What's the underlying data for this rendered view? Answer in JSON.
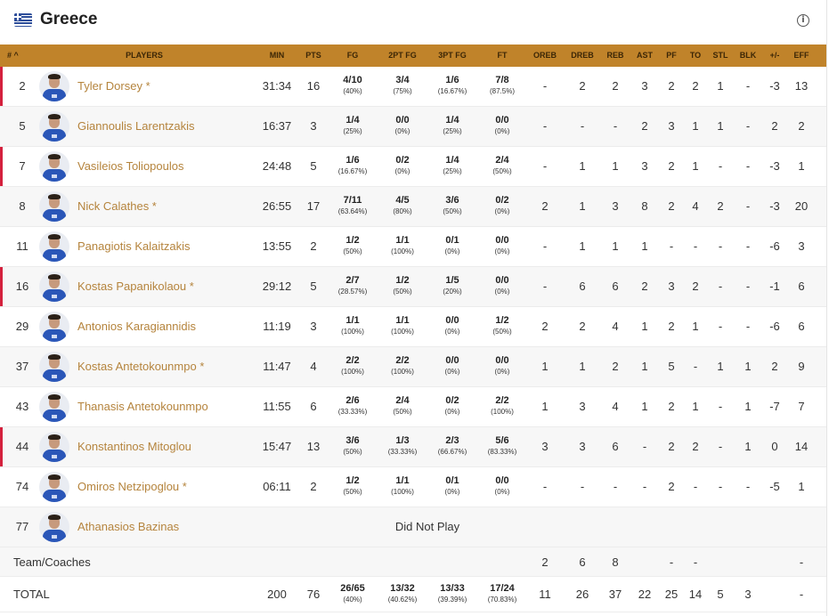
{
  "team": {
    "name": "Greece",
    "flag_icon": "greece-flag-icon",
    "info_icon": "info-icon"
  },
  "columns": [
    "#",
    "PLAYERS",
    "MIN",
    "PTS",
    "FG",
    "2PT FG",
    "3PT FG",
    "FT",
    "OREB",
    "DREB",
    "REB",
    "AST",
    "PF",
    "TO",
    "STL",
    "BLK",
    "+/-",
    "EFF"
  ],
  "sort_indicator": "^",
  "players": [
    {
      "num": "2",
      "name": "Tyler Dorsey *",
      "min": "31:34",
      "pts": "16",
      "fg": "4/10",
      "fg_pct": "(40%)",
      "fg2": "3/4",
      "fg2_pct": "(75%)",
      "fg3": "1/6",
      "fg3_pct": "(16.67%)",
      "ft": "7/8",
      "ft_pct": "(87.5%)",
      "oreb": "-",
      "dreb": "2",
      "reb": "2",
      "ast": "3",
      "pf": "2",
      "to": "2",
      "stl": "1",
      "blk": "-",
      "pm": "-3",
      "eff": "13",
      "marker": true
    },
    {
      "num": "5",
      "name": "Giannoulis Larentzakis",
      "min": "16:37",
      "pts": "3",
      "fg": "1/4",
      "fg_pct": "(25%)",
      "fg2": "0/0",
      "fg2_pct": "(0%)",
      "fg3": "1/4",
      "fg3_pct": "(25%)",
      "ft": "0/0",
      "ft_pct": "(0%)",
      "oreb": "-",
      "dreb": "-",
      "reb": "-",
      "ast": "2",
      "pf": "3",
      "to": "1",
      "stl": "1",
      "blk": "-",
      "pm": "2",
      "eff": "2",
      "marker": false
    },
    {
      "num": "7",
      "name": "Vasileios Toliopoulos",
      "min": "24:48",
      "pts": "5",
      "fg": "1/6",
      "fg_pct": "(16.67%)",
      "fg2": "0/2",
      "fg2_pct": "(0%)",
      "fg3": "1/4",
      "fg3_pct": "(25%)",
      "ft": "2/4",
      "ft_pct": "(50%)",
      "oreb": "-",
      "dreb": "1",
      "reb": "1",
      "ast": "3",
      "pf": "2",
      "to": "1",
      "stl": "-",
      "blk": "-",
      "pm": "-3",
      "eff": "1",
      "marker": true
    },
    {
      "num": "8",
      "name": "Nick Calathes *",
      "min": "26:55",
      "pts": "17",
      "fg": "7/11",
      "fg_pct": "(63.64%)",
      "fg2": "4/5",
      "fg2_pct": "(80%)",
      "fg3": "3/6",
      "fg3_pct": "(50%)",
      "ft": "0/2",
      "ft_pct": "(0%)",
      "oreb": "2",
      "dreb": "1",
      "reb": "3",
      "ast": "8",
      "pf": "2",
      "to": "4",
      "stl": "2",
      "blk": "-",
      "pm": "-3",
      "eff": "20",
      "marker": false
    },
    {
      "num": "11",
      "name": "Panagiotis Kalaitzakis",
      "min": "13:55",
      "pts": "2",
      "fg": "1/2",
      "fg_pct": "(50%)",
      "fg2": "1/1",
      "fg2_pct": "(100%)",
      "fg3": "0/1",
      "fg3_pct": "(0%)",
      "ft": "0/0",
      "ft_pct": "(0%)",
      "oreb": "-",
      "dreb": "1",
      "reb": "1",
      "ast": "1",
      "pf": "-",
      "to": "-",
      "stl": "-",
      "blk": "-",
      "pm": "-6",
      "eff": "3",
      "marker": false
    },
    {
      "num": "16",
      "name": "Kostas Papanikolaou *",
      "min": "29:12",
      "pts": "5",
      "fg": "2/7",
      "fg_pct": "(28.57%)",
      "fg2": "1/2",
      "fg2_pct": "(50%)",
      "fg3": "1/5",
      "fg3_pct": "(20%)",
      "ft": "0/0",
      "ft_pct": "(0%)",
      "oreb": "-",
      "dreb": "6",
      "reb": "6",
      "ast": "2",
      "pf": "3",
      "to": "2",
      "stl": "-",
      "blk": "-",
      "pm": "-1",
      "eff": "6",
      "marker": true
    },
    {
      "num": "29",
      "name": "Antonios Karagiannidis",
      "min": "11:19",
      "pts": "3",
      "fg": "1/1",
      "fg_pct": "(100%)",
      "fg2": "1/1",
      "fg2_pct": "(100%)",
      "fg3": "0/0",
      "fg3_pct": "(0%)",
      "ft": "1/2",
      "ft_pct": "(50%)",
      "oreb": "2",
      "dreb": "2",
      "reb": "4",
      "ast": "1",
      "pf": "2",
      "to": "1",
      "stl": "-",
      "blk": "-",
      "pm": "-6",
      "eff": "6",
      "marker": false
    },
    {
      "num": "37",
      "name": "Kostas Antetokounmpo *",
      "min": "11:47",
      "pts": "4",
      "fg": "2/2",
      "fg_pct": "(100%)",
      "fg2": "2/2",
      "fg2_pct": "(100%)",
      "fg3": "0/0",
      "fg3_pct": "(0%)",
      "ft": "0/0",
      "ft_pct": "(0%)",
      "oreb": "1",
      "dreb": "1",
      "reb": "2",
      "ast": "1",
      "pf": "5",
      "to": "-",
      "stl": "1",
      "blk": "1",
      "pm": "2",
      "eff": "9",
      "marker": false
    },
    {
      "num": "43",
      "name": "Thanasis Antetokounmpo",
      "min": "11:55",
      "pts": "6",
      "fg": "2/6",
      "fg_pct": "(33.33%)",
      "fg2": "2/4",
      "fg2_pct": "(50%)",
      "fg3": "0/2",
      "fg3_pct": "(0%)",
      "ft": "2/2",
      "ft_pct": "(100%)",
      "oreb": "1",
      "dreb": "3",
      "reb": "4",
      "ast": "1",
      "pf": "2",
      "to": "1",
      "stl": "-",
      "blk": "1",
      "pm": "-7",
      "eff": "7",
      "marker": false
    },
    {
      "num": "44",
      "name": "Konstantinos Mitoglou",
      "min": "15:47",
      "pts": "13",
      "fg": "3/6",
      "fg_pct": "(50%)",
      "fg2": "1/3",
      "fg2_pct": "(33.33%)",
      "fg3": "2/3",
      "fg3_pct": "(66.67%)",
      "ft": "5/6",
      "ft_pct": "(83.33%)",
      "oreb": "3",
      "dreb": "3",
      "reb": "6",
      "ast": "-",
      "pf": "2",
      "to": "2",
      "stl": "-",
      "blk": "1",
      "pm": "0",
      "eff": "14",
      "marker": true
    },
    {
      "num": "74",
      "name": "Omiros Netzipoglou *",
      "min": "06:11",
      "pts": "2",
      "fg": "1/2",
      "fg_pct": "(50%)",
      "fg2": "1/1",
      "fg2_pct": "(100%)",
      "fg3": "0/1",
      "fg3_pct": "(0%)",
      "ft": "0/0",
      "ft_pct": "(0%)",
      "oreb": "-",
      "dreb": "-",
      "reb": "-",
      "ast": "-",
      "pf": "2",
      "to": "-",
      "stl": "-",
      "blk": "-",
      "pm": "-5",
      "eff": "1",
      "marker": false
    },
    {
      "num": "77",
      "name": "Athanasios Bazinas",
      "dnp": "Did Not Play",
      "marker": false
    }
  ],
  "team_coaches": {
    "label": "Team/Coaches",
    "oreb": "2",
    "dreb": "6",
    "reb": "8",
    "pf": "-",
    "to": "-",
    "eff": "-"
  },
  "total": {
    "label": "TOTAL",
    "min": "200",
    "pts": "76",
    "fg": "26/65",
    "fg_pct": "(40%)",
    "fg2": "13/32",
    "fg2_pct": "(40.62%)",
    "fg3": "13/33",
    "fg3_pct": "(39.39%)",
    "ft": "17/24",
    "ft_pct": "(70.83%)",
    "oreb": "11",
    "dreb": "26",
    "reb": "37",
    "ast": "22",
    "pf": "25",
    "to": "14",
    "stl": "5",
    "blk": "3",
    "eff": "-"
  },
  "colors": {
    "header_bg": "#c0832a",
    "name_link": "#b5843d",
    "starter_marker": "#d4213d"
  }
}
